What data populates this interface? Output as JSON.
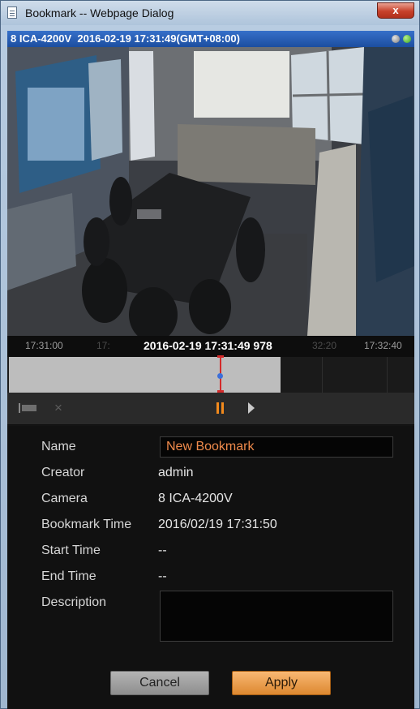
{
  "window": {
    "title": "Bookmark -- Webpage Dialog",
    "close_label": "x"
  },
  "camera": {
    "header": "8 ICA-4200V  2016-02-19 17:31:49(GMT+08:00)"
  },
  "ruler": {
    "ticks": [
      "17:31:00",
      "17:",
      "32:20",
      "17:32:40"
    ],
    "cursor_time": "2016-02-19 17:31:49 978"
  },
  "controls": {
    "delete_glyph": "×"
  },
  "form": {
    "name_label": "Name",
    "name_value": "New Bookmark",
    "creator_label": "Creator",
    "creator_value": "admin",
    "camera_label": "Camera",
    "camera_value": "8 ICA-4200V",
    "bookmark_time_label": "Bookmark Time",
    "bookmark_time_value": "2016/02/19 17:31:50",
    "start_time_label": "Start Time",
    "start_time_value": "--",
    "end_time_label": "End Time",
    "end_time_value": "--",
    "description_label": "Description",
    "description_value": ""
  },
  "buttons": {
    "cancel": "Cancel",
    "apply": "Apply"
  },
  "colors": {
    "accent_orange": "#f28a1c",
    "header_blue": "#2a5fb7",
    "status_green": "#34a11f"
  }
}
